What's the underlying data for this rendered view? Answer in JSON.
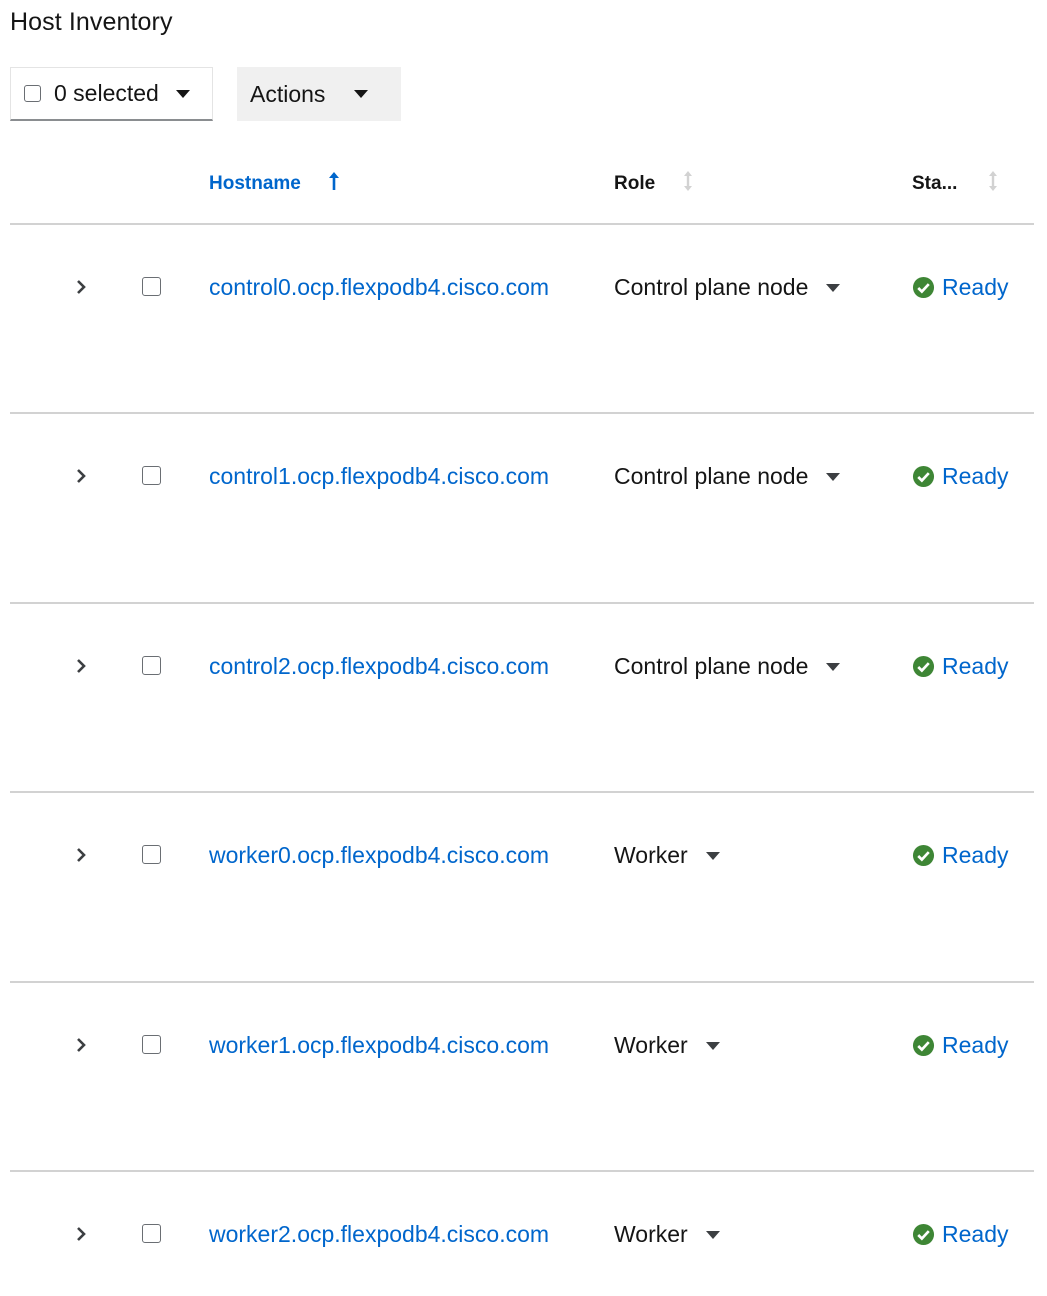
{
  "page": {
    "title": "Host Inventory"
  },
  "toolbar": {
    "bulk_select_label": "0 selected",
    "actions_label": "Actions"
  },
  "table": {
    "columns": {
      "hostname": "Hostname",
      "role": "Role",
      "status": "Sta..."
    },
    "sort": {
      "column": "hostname",
      "direction": "ascending"
    },
    "rows": [
      {
        "hostname": "control0.ocp.flexpodb4.cisco.com",
        "role": "Control plane node",
        "status": "Ready"
      },
      {
        "hostname": "control1.ocp.flexpodb4.cisco.com",
        "role": "Control plane node",
        "status": "Ready"
      },
      {
        "hostname": "control2.ocp.flexpodb4.cisco.com",
        "role": "Control plane node",
        "status": "Ready"
      },
      {
        "hostname": "worker0.ocp.flexpodb4.cisco.com",
        "role": "Worker",
        "status": "Ready"
      },
      {
        "hostname": "worker1.ocp.flexpodb4.cisco.com",
        "role": "Worker",
        "status": "Ready"
      },
      {
        "hostname": "worker2.ocp.flexpodb4.cisco.com",
        "role": "Worker",
        "status": "Ready"
      }
    ]
  },
  "colors": {
    "link": "#0066cc",
    "success": "#3e8635",
    "text": "#151515",
    "divider": "#d2d2d2"
  },
  "icons": {
    "expand": "chevron-right-icon",
    "status_ready": "check-circle-icon",
    "sort_active": "arrow-up-icon",
    "sort_inactive": "sort-arrows-icon",
    "dropdown": "caret-down-icon"
  }
}
